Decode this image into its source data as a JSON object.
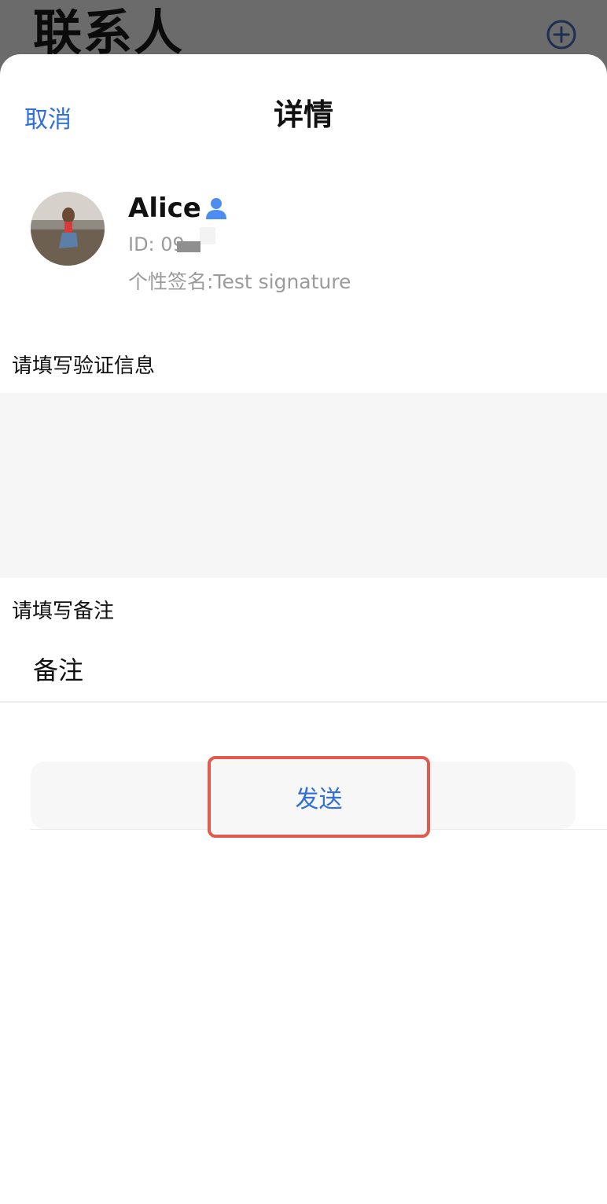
{
  "background": {
    "title": "联系人",
    "add_icon": "plus-circle-icon"
  },
  "sheet": {
    "cancel_label": "取消",
    "title": "详情"
  },
  "profile": {
    "name": "Alice",
    "name_icon": "user-icon",
    "id_text": "ID: 09",
    "signature": "个性签名:Test signature"
  },
  "verification": {
    "label": "请填写验证信息",
    "value": ""
  },
  "remark": {
    "label": "请填写备注",
    "placeholder": "备注",
    "value": ""
  },
  "actions": {
    "send_label": "发送"
  },
  "colors": {
    "accent": "#2f6fdb",
    "highlight": "#e05a4e"
  }
}
